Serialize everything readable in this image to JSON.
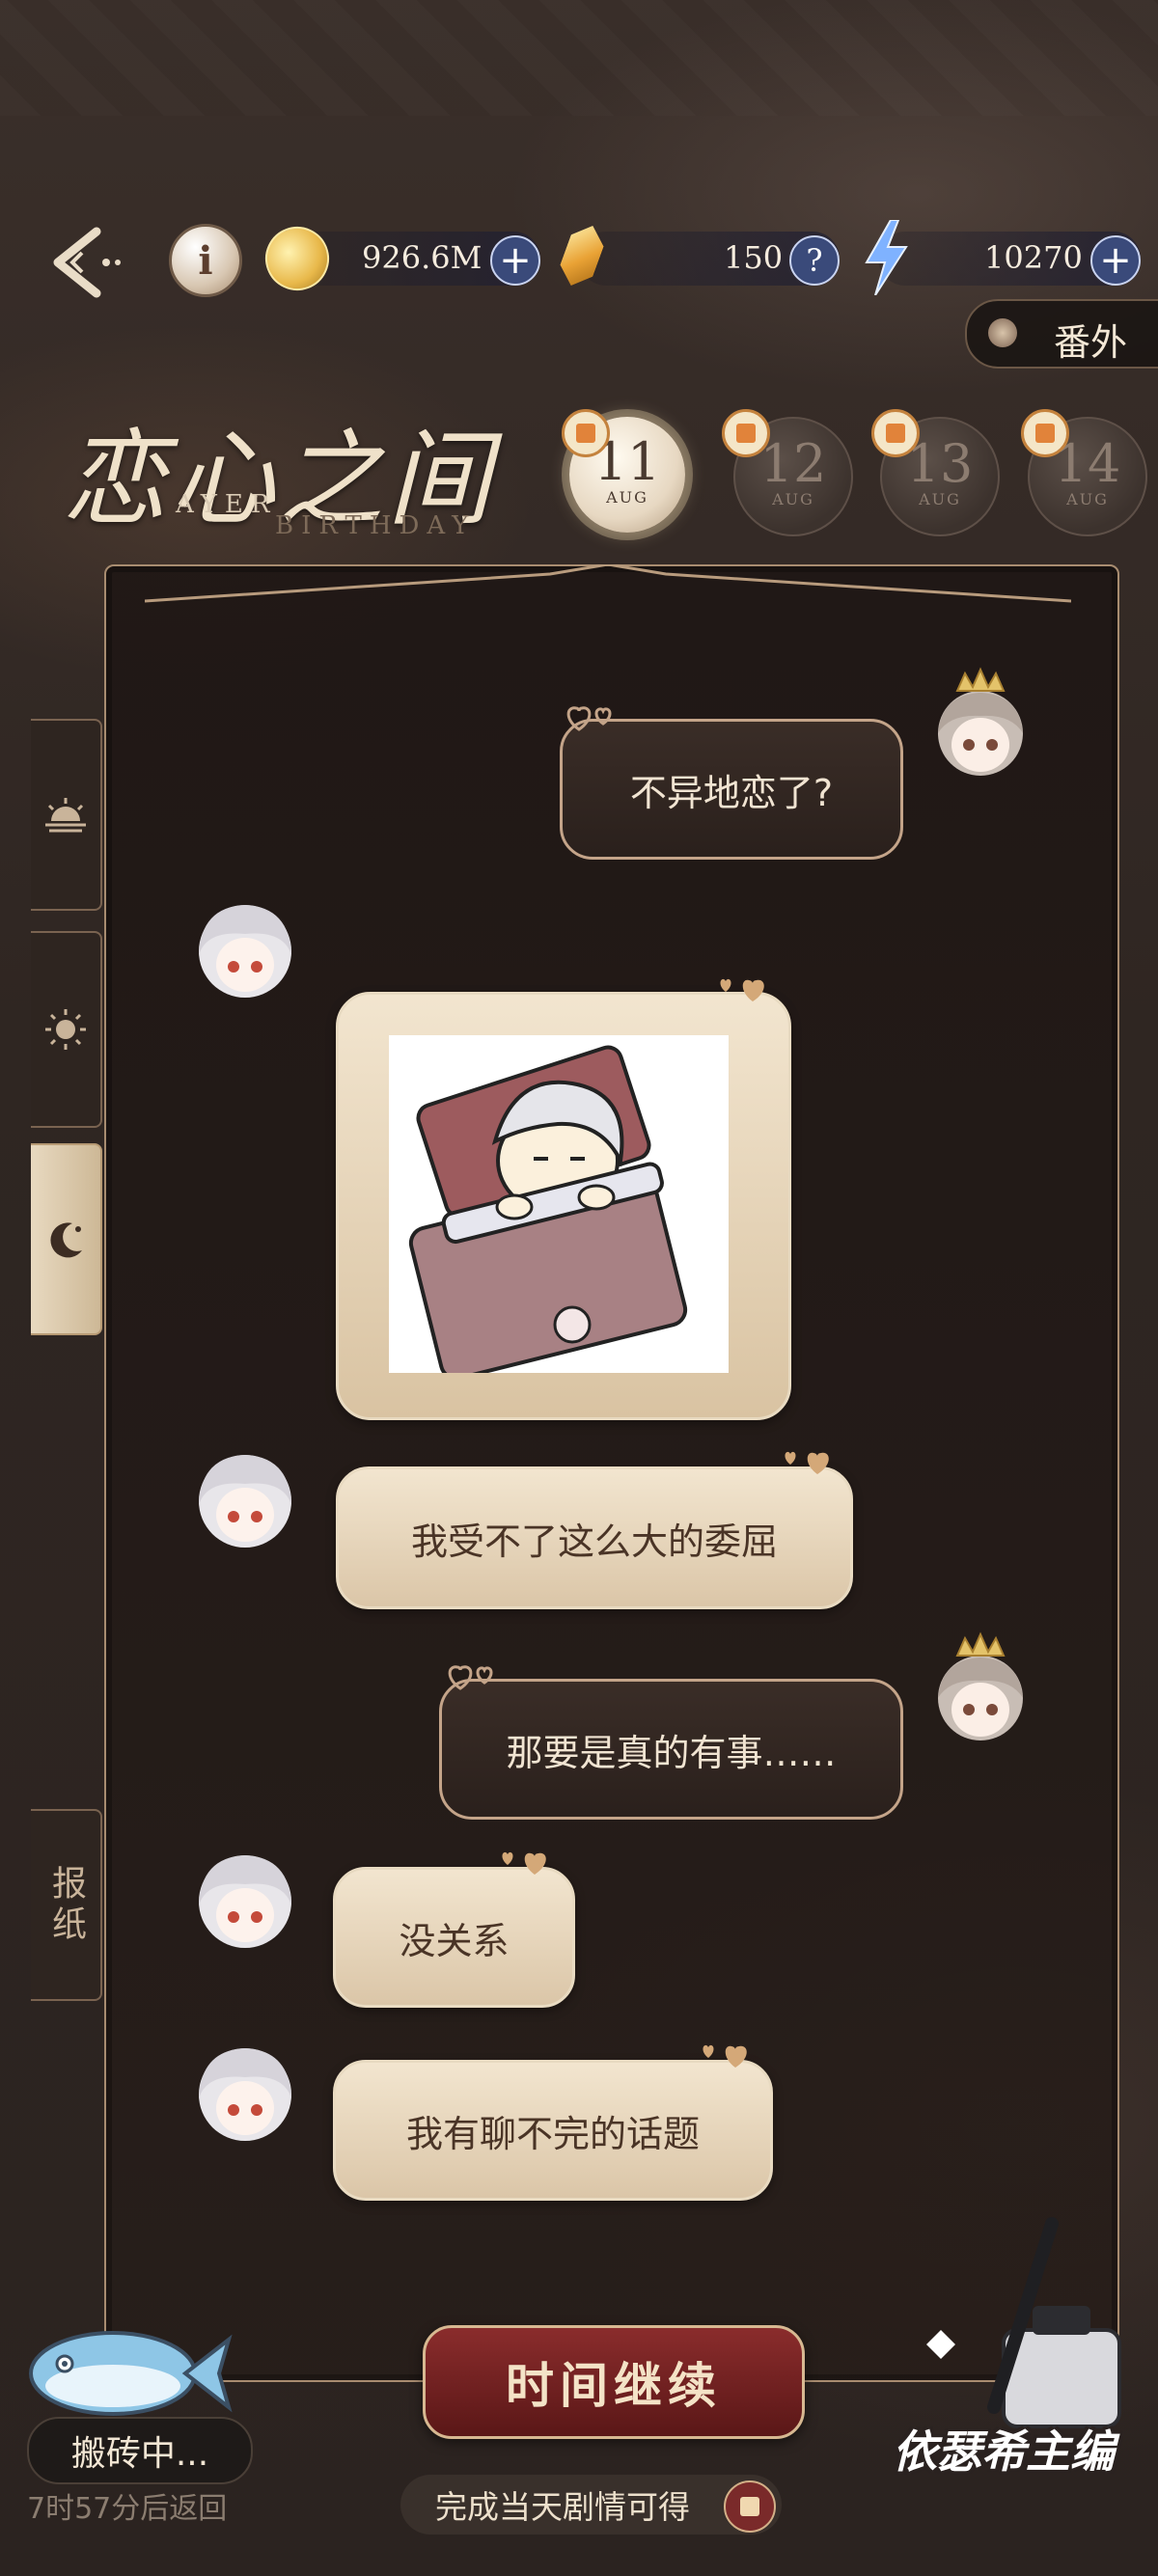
{
  "top_bar": {
    "coins": "926.6M",
    "gems": "150",
    "energy": "10270",
    "extra_label": "番外"
  },
  "title": {
    "main": "恋心之间",
    "sub1": "AYER",
    "sub2": "BIRTHDAY"
  },
  "dates": [
    {
      "day": "11",
      "month": "AUG",
      "active": true
    },
    {
      "day": "12",
      "month": "AUG",
      "active": false
    },
    {
      "day": "13",
      "month": "AUG",
      "active": false
    },
    {
      "day": "14",
      "month": "AUG",
      "active": false
    }
  ],
  "side_tabs": {
    "newspaper": "报纸"
  },
  "messages": [
    {
      "from": "me",
      "text": "不异地恋了?"
    },
    {
      "from": "him",
      "type": "sticker",
      "sticker": "sleeping-in-bed-sticker"
    },
    {
      "from": "him",
      "text": "我受不了这么大的委屈"
    },
    {
      "from": "me",
      "text": "那要是真的有事……"
    },
    {
      "from": "him",
      "text": "没关系"
    },
    {
      "from": "him",
      "text": "我有聊不完的话题"
    }
  ],
  "bottom": {
    "continue_label": "时间继续",
    "reward_text": "完成当天剧情可得",
    "moving_label": "搬砖中...",
    "return_time": "7时57分后返回",
    "editor_label": "依瑟希主编"
  },
  "colors": {
    "accent_gold": "#d7b891",
    "continue_red": "#7a2424",
    "bubble_light": "#ecdcc2",
    "bubble_dark": "#2f241f"
  }
}
